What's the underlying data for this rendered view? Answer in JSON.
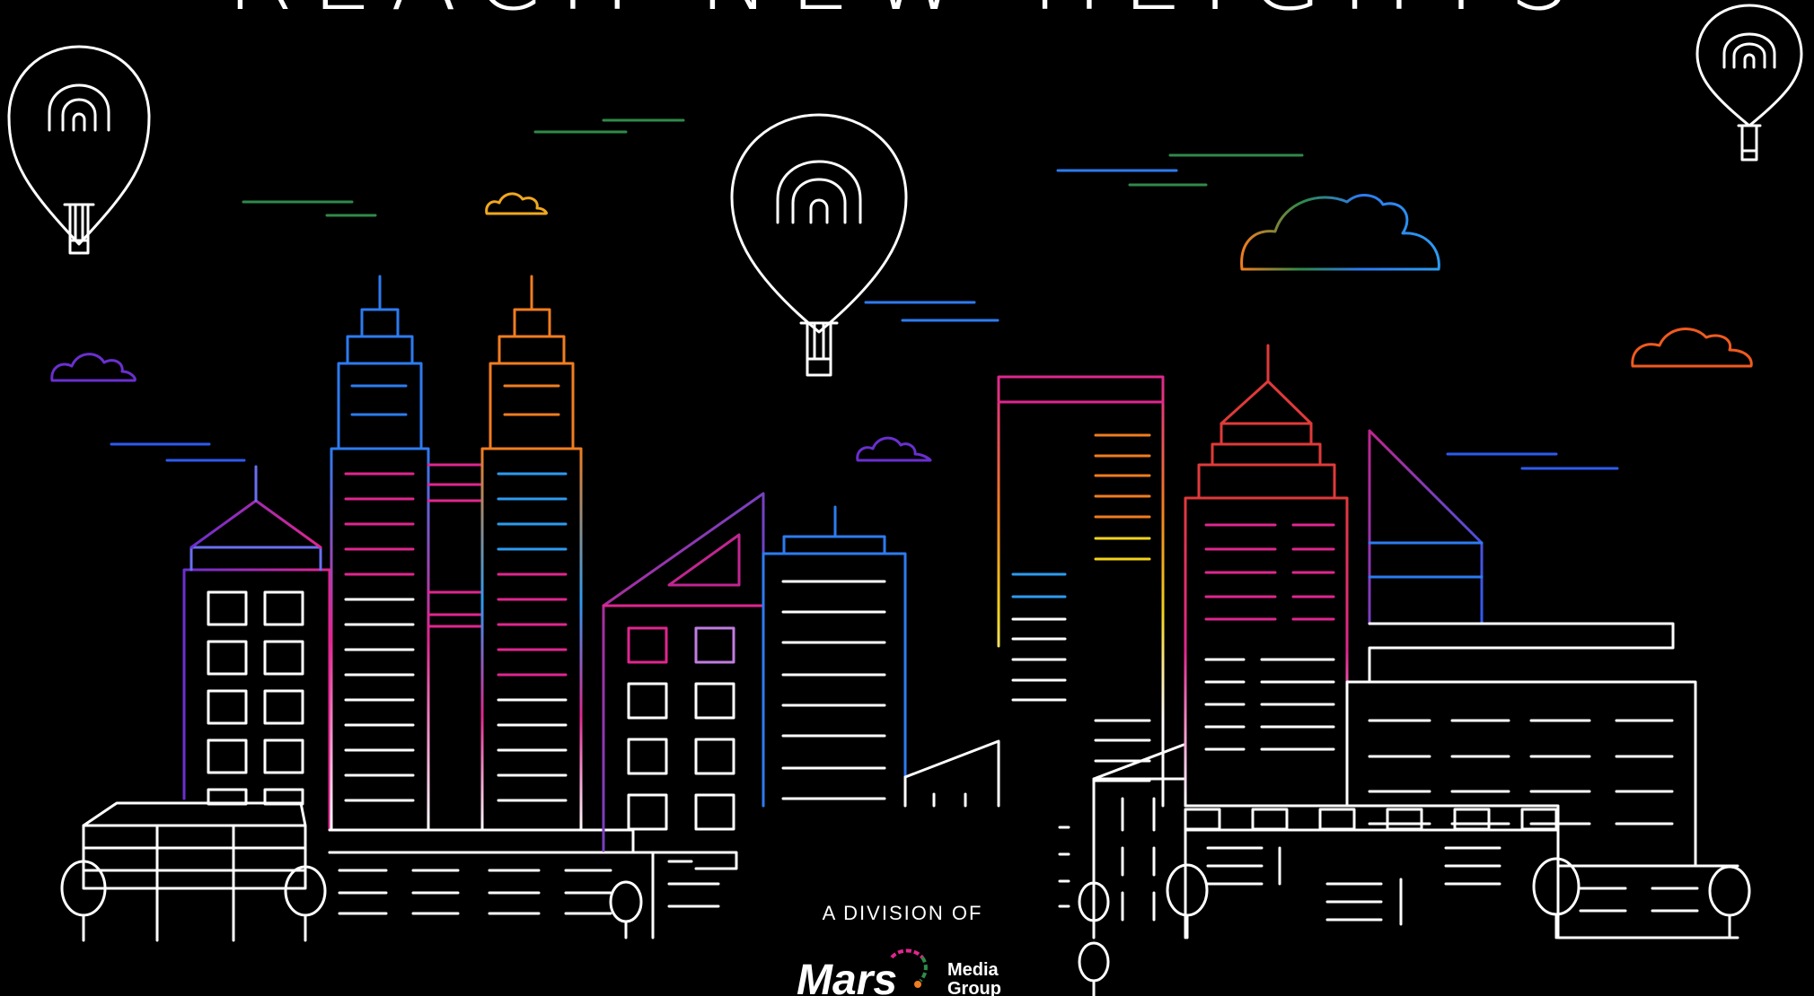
{
  "banner": {
    "title": "REACH NEW HEIGHTS",
    "division_label": "A DIVISION OF",
    "logo": {
      "name": "Mars",
      "line1": "Media",
      "line2": "Group"
    }
  },
  "colors": {
    "background": "#000000",
    "line": "#ffffff",
    "blue": "#2d7bf0",
    "pink": "#e0268f",
    "orange": "#f07d1f",
    "purple": "#6a2fcf",
    "green": "#2f8a4a",
    "yellow": "#f2d31b"
  },
  "icons": [
    "hot-air-balloon-icon",
    "cloud-icon",
    "city-skyline-illustration",
    "mars-media-group-logo"
  ]
}
